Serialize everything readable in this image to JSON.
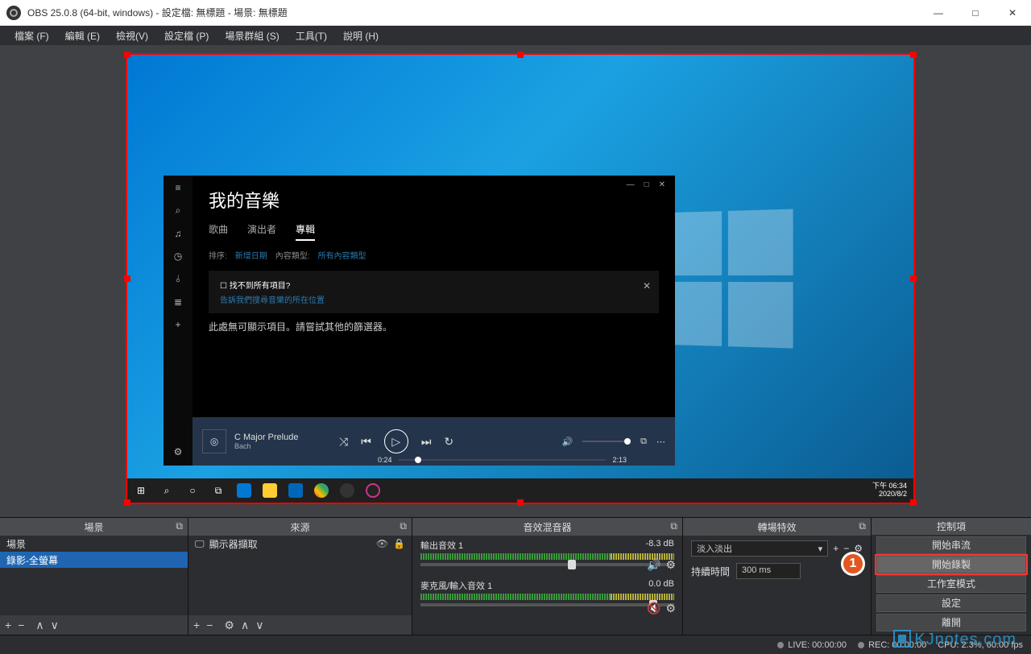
{
  "window": {
    "title": "OBS 25.0.8 (64-bit, windows) - 設定檔: 無標題 - 場景: 無標題",
    "min": "—",
    "max": "□",
    "close": "✕"
  },
  "menu": {
    "file": "檔案 (F)",
    "edit": "編輯 (E)",
    "view": "檢視(V)",
    "profile": "設定檔 (P)",
    "scenecol": "場景群組 (S)",
    "tools": "工具(T)",
    "help": "說明 (H)"
  },
  "desktop": {
    "clock_time": "下午 06:34",
    "clock_date": "2020/8/2"
  },
  "music": {
    "title": "我的音樂",
    "tab_songs": "歌曲",
    "tab_artists": "演出者",
    "tab_albums": "專輯",
    "filter_label": "排序:",
    "filter_val": "新增日期",
    "type_label": "內容類型:",
    "type_val": "所有內容類型",
    "notice_q": "找不到所有項目?",
    "notice_link": "告訴我們搜尋音樂的所在位置",
    "empty": "此處無可顯示項目。請嘗試其他的篩選器。",
    "track_title": "C Major Prelude",
    "track_artist": "Bach",
    "time_cur": "0:24",
    "time_total": "2:13"
  },
  "panels": {
    "scenes": "場景",
    "sources": "來源",
    "mixer": "音效混音器",
    "trans": "轉場特效",
    "controls": "控制項"
  },
  "scenes": {
    "items": [
      "場景",
      "錄影-全螢幕"
    ]
  },
  "sources": {
    "items": [
      "顯示器擷取"
    ]
  },
  "mixer": {
    "ch1_name": "輸出音效 1",
    "ch1_db": "-8.3 dB",
    "ch2_name": "麥克風/輸入音效 1",
    "ch2_db": "0.0 dB"
  },
  "trans": {
    "selected": "淡入淡出",
    "dur_label": "持續時間",
    "dur_val": "300 ms"
  },
  "controls": {
    "stream": "開始串流",
    "record": "開始錄製",
    "studio": "工作室模式",
    "settings": "設定",
    "exit": "離開"
  },
  "callout": "1",
  "status": {
    "live": "LIVE: 00:00:00",
    "rec": "REC: 00:00:00",
    "cpu": "CPU: 2.3%, 60.00 fps"
  },
  "watermark": "KJnotes.com"
}
